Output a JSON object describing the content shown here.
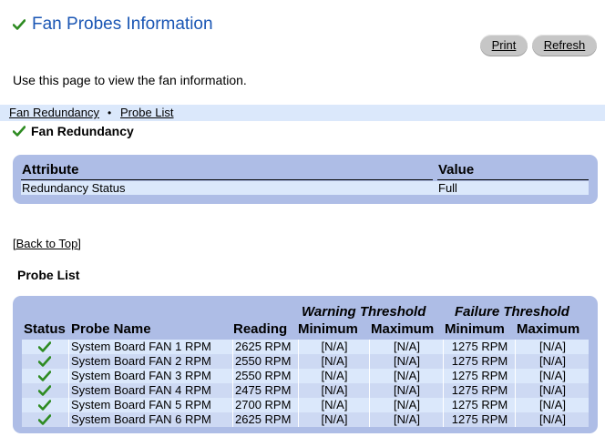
{
  "page": {
    "title": "Fan Probes Information",
    "intro": "Use this page to view the fan information."
  },
  "toolbar": {
    "print_label": "Print",
    "refresh_label": "Refresh"
  },
  "breadcrumb": {
    "item1": "Fan Redundancy",
    "separator": "•",
    "item2": "Probe List"
  },
  "redundancy": {
    "heading": "Fan Redundancy",
    "col_attribute": "Attribute",
    "col_value": "Value",
    "rows": [
      {
        "attribute": "Redundancy Status",
        "value": "Full"
      }
    ]
  },
  "back_to_top": "[Back to Top]",
  "probe_list": {
    "heading": "Probe List",
    "group_warning": "Warning Threshold",
    "group_failure": "Failure Threshold",
    "col_status": "Status",
    "col_name": "Probe Name",
    "col_reading": "Reading",
    "col_warn_min": "Minimum",
    "col_warn_max": "Maximum",
    "col_fail_min": "Minimum",
    "col_fail_max": "Maximum",
    "rows": [
      {
        "status": "ok-check-icon",
        "name": "System Board FAN 1 RPM",
        "reading": "2625 RPM",
        "warn_min": "[N/A]",
        "warn_max": "[N/A]",
        "fail_min": "1275 RPM",
        "fail_max": "[N/A]"
      },
      {
        "status": "ok-check-icon",
        "name": "System Board FAN 2 RPM",
        "reading": "2550 RPM",
        "warn_min": "[N/A]",
        "warn_max": "[N/A]",
        "fail_min": "1275 RPM",
        "fail_max": "[N/A]"
      },
      {
        "status": "ok-check-icon",
        "name": "System Board FAN 3 RPM",
        "reading": "2550 RPM",
        "warn_min": "[N/A]",
        "warn_max": "[N/A]",
        "fail_min": "1275 RPM",
        "fail_max": "[N/A]"
      },
      {
        "status": "ok-check-icon",
        "name": "System Board FAN 4 RPM",
        "reading": "2475 RPM",
        "warn_min": "[N/A]",
        "warn_max": "[N/A]",
        "fail_min": "1275 RPM",
        "fail_max": "[N/A]"
      },
      {
        "status": "ok-check-icon",
        "name": "System Board FAN 5 RPM",
        "reading": "2700 RPM",
        "warn_min": "[N/A]",
        "warn_max": "[N/A]",
        "fail_min": "1275 RPM",
        "fail_max": "[N/A]"
      },
      {
        "status": "ok-check-icon",
        "name": "System Board FAN 6 RPM",
        "reading": "2625 RPM",
        "warn_min": "[N/A]",
        "warn_max": "[N/A]",
        "fail_min": "1275 RPM",
        "fail_max": "[N/A]"
      }
    ]
  },
  "colors": {
    "title_blue": "#1a56b4",
    "panel": "#aebde6",
    "row_light": "#dbe8fb",
    "row_alt": "#cdd9f3",
    "check_green": "#2e8b22"
  }
}
